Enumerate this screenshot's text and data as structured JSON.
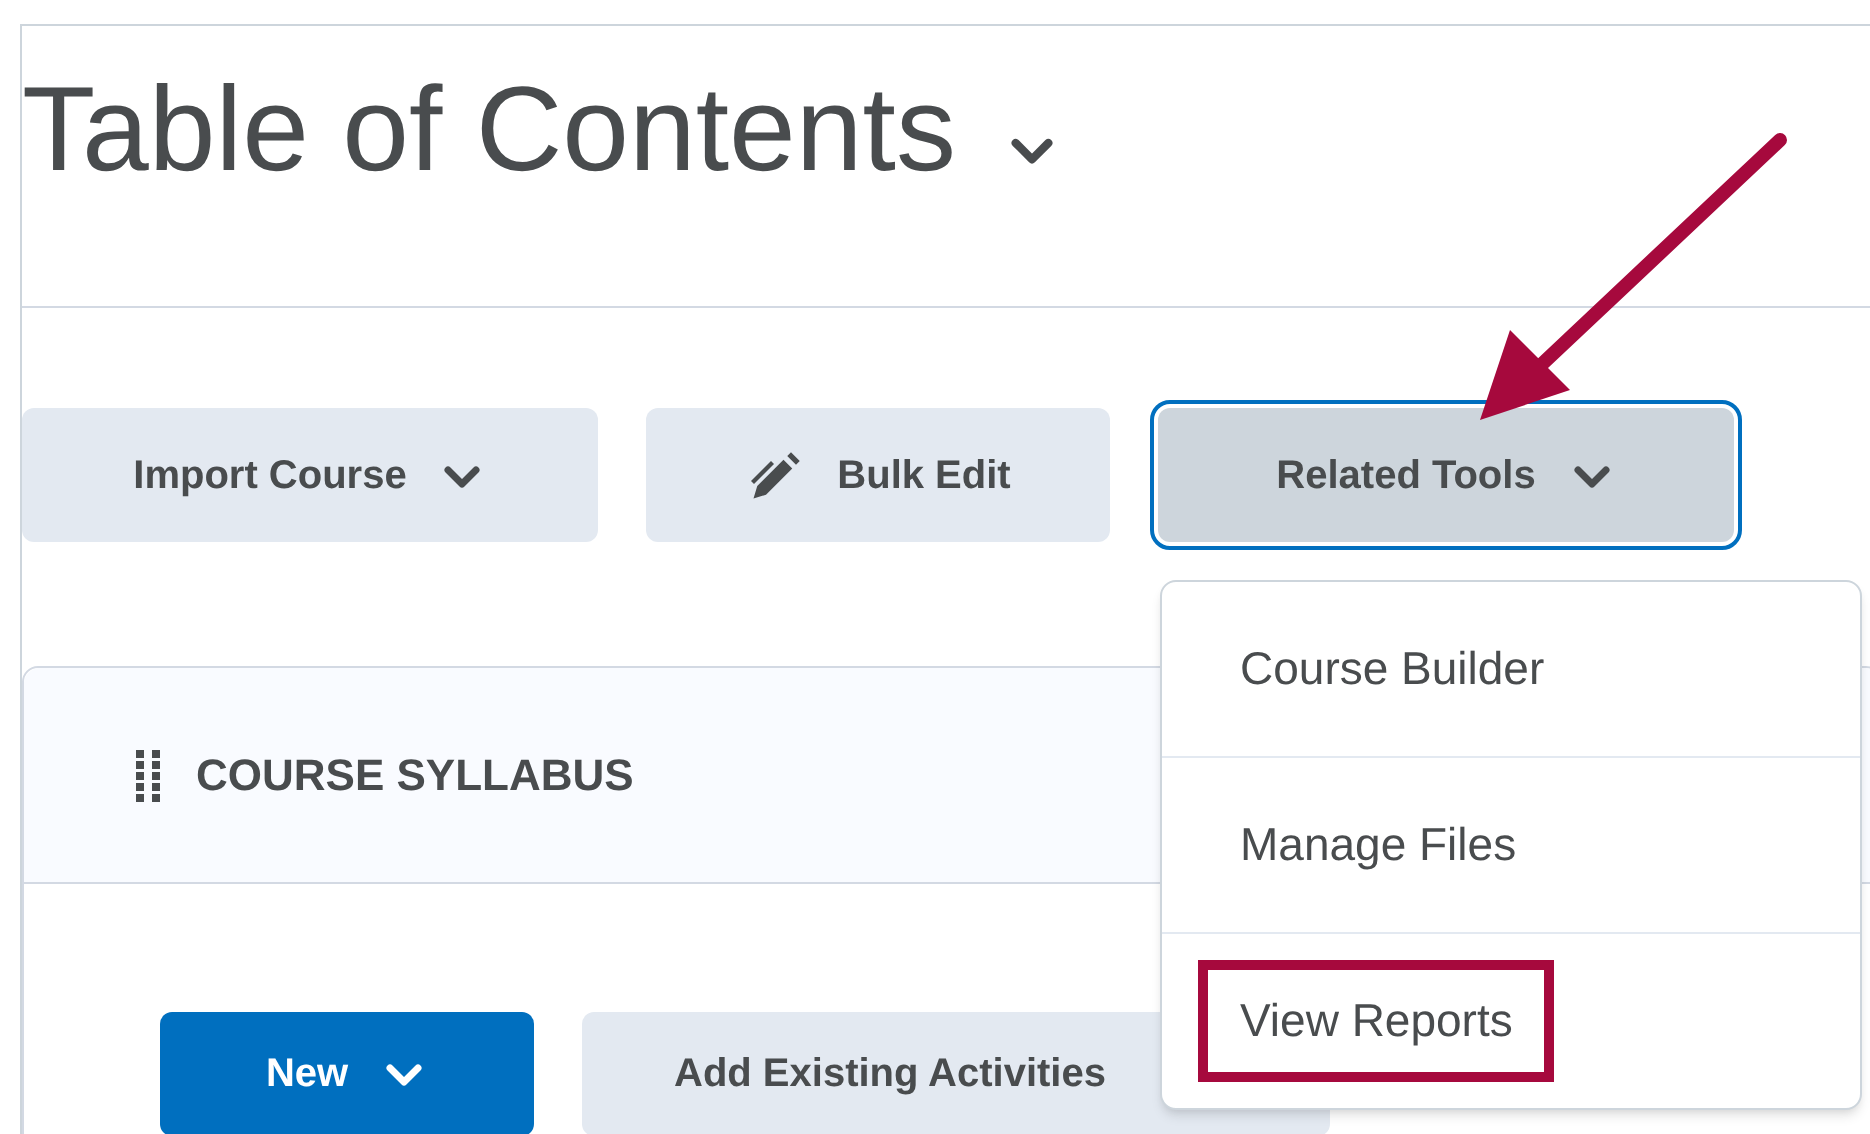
{
  "page_title": "Table of Contents",
  "toolbar": [
    {
      "label": "Import Course",
      "kind": "dropdown",
      "focused": false
    },
    {
      "label": "Bulk Edit",
      "kind": "edit",
      "focused": false
    },
    {
      "label": "Related Tools",
      "kind": "dropdown",
      "focused": true
    }
  ],
  "menu": [
    {
      "label": "Course Builder",
      "highlighted": false
    },
    {
      "label": "Manage Files",
      "highlighted": false
    },
    {
      "label": "View Reports",
      "highlighted": true
    }
  ],
  "module": {
    "title": "COURSE SYLLABUS",
    "buttons": [
      {
        "label": "New",
        "kind": "primary"
      },
      {
        "label": "Add Existing Activities",
        "kind": "secondary"
      }
    ]
  }
}
